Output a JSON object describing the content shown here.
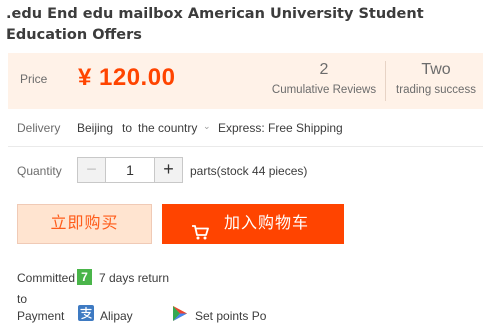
{
  "product": {
    "title": ".edu End edu mailbox American University Student Education Offers"
  },
  "price": {
    "label": "Price",
    "value": "¥ 120.00"
  },
  "stats": {
    "reviews_count": "2",
    "reviews_label": "Cumulative Reviews",
    "trading_count": "Two",
    "trading_label": "trading success"
  },
  "delivery": {
    "label": "Delivery",
    "from": "Beijing",
    "to_word": "to",
    "destination": "the country",
    "shipping": "Express: Free Shipping"
  },
  "quantity": {
    "label": "Quantity",
    "minus": "−",
    "value": "1",
    "plus": "+",
    "stock_text": "parts(stock 44 pieces)"
  },
  "actions": {
    "buy_now": "立即购买",
    "add_to_cart": "加入购物车"
  },
  "services": {
    "committed_label": "Committed",
    "to_label": "to",
    "seven_badge": "7",
    "seven_text": "7 days return"
  },
  "payment": {
    "label": "Payment",
    "alipay": "Alipay",
    "points": "Set points Po"
  },
  "colors": {
    "accent": "#ff4400",
    "price_bg": "#fff2e8",
    "buy_bg": "#ffe4d0",
    "seven_green": "#4ab54a"
  },
  "icons": {
    "chevron": "chevron-down-icon",
    "cart": "cart-icon",
    "seven_day": "seven-day-return-icon",
    "alipay": "alipay-icon",
    "points": "points-icon"
  }
}
